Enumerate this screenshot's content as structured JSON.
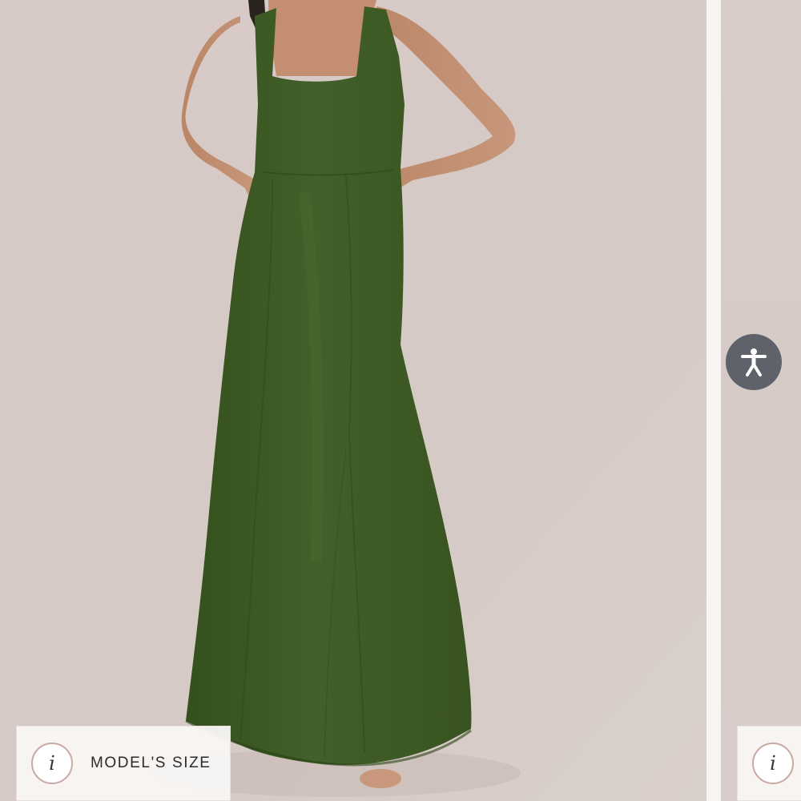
{
  "gallery": {
    "main_image_alt": "Olive green square-neck sleeveless maxi dress",
    "models_size_label": "MODEL'S SIZE",
    "info_glyph": "i",
    "next_info_glyph": "i"
  },
  "accessibility": {
    "icon": "accessibility-person-icon",
    "color": "#5f626a"
  },
  "colors": {
    "backdrop": "#d8ccc8",
    "dress": "#3f5a25",
    "badge_border": "#c9a9a4"
  }
}
